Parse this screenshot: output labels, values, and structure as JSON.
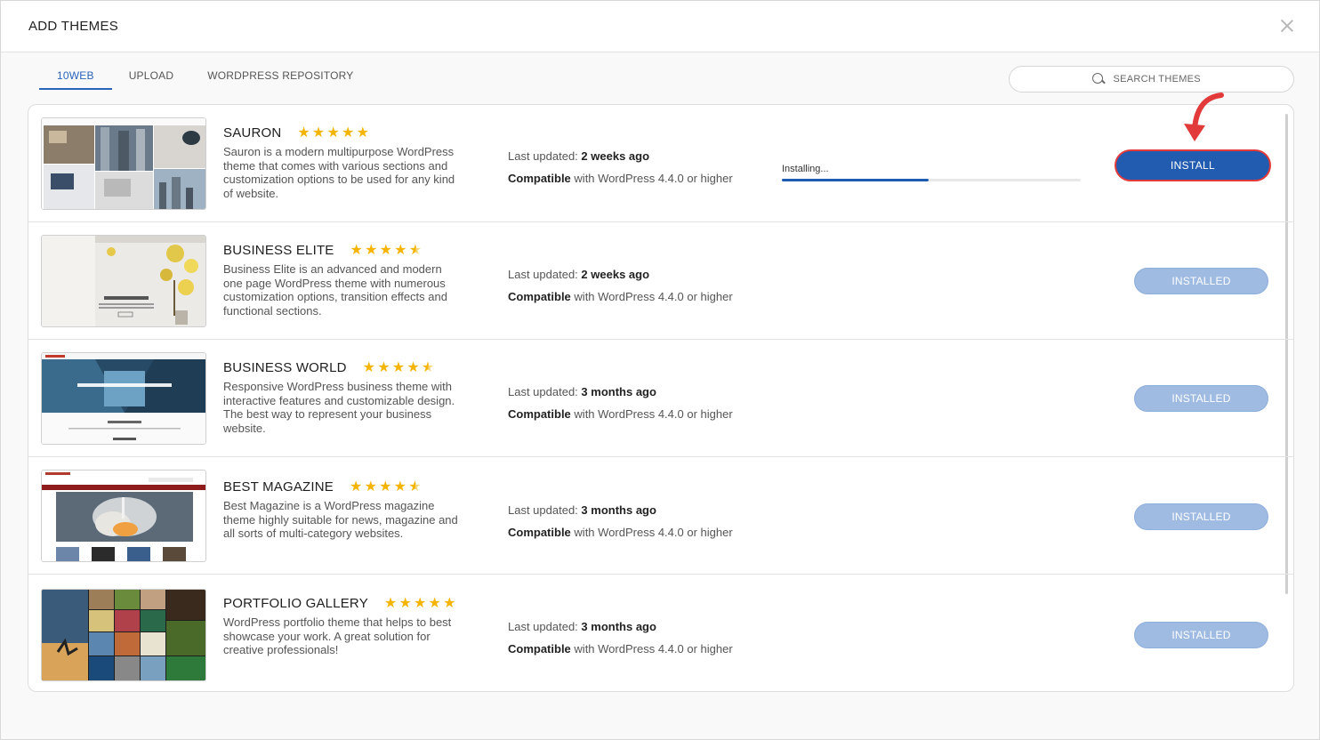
{
  "modal": {
    "title": "ADD THEMES"
  },
  "tabs": [
    {
      "label": "10WEB",
      "active": true
    },
    {
      "label": "UPLOAD",
      "active": false
    },
    {
      "label": "WORDPRESS REPOSITORY",
      "active": false
    }
  ],
  "search": {
    "placeholder": "SEARCH THEMES"
  },
  "meta_labels": {
    "last_updated": "Last updated:",
    "compatible": "Compatible",
    "compat_text": "with WordPress 4.4.0 or higher"
  },
  "themes": [
    {
      "name": "SAURON",
      "rating": 5,
      "description": "Sauron is a modern multipurpose WordPress theme that comes with various sections and customization options to be used for any kind of website.",
      "last_updated": "2 weeks ago",
      "status": "installing",
      "progress_label": "Installing...",
      "progress": 0.49,
      "button": "INSTALL"
    },
    {
      "name": "BUSINESS ELITE",
      "rating": 4.5,
      "description": "Business Elite is an advanced and modern one page WordPress theme with numerous customization options, transition effects and functional sections.",
      "last_updated": "2 weeks ago",
      "status": "installed",
      "button": "INSTALLED"
    },
    {
      "name": "BUSINESS WORLD",
      "rating": 4.5,
      "description": "Responsive WordPress business theme with interactive features and customizable design. The best way to represent your business website.",
      "last_updated": "3 months ago",
      "status": "installed",
      "button": "INSTALLED"
    },
    {
      "name": "BEST MAGAZINE",
      "rating": 4.5,
      "description": "Best Magazine is a WordPress magazine theme highly suitable for news, magazine and all sorts of multi-category websites.",
      "last_updated": "3 months ago",
      "status": "installed",
      "button": "INSTALLED"
    },
    {
      "name": "PORTFOLIO GALLERY",
      "rating": 5,
      "description": "WordPress portfolio theme that helps to best showcase your work. A great solution for creative professionals!",
      "last_updated": "3 months ago",
      "status": "installed",
      "button": "INSTALLED"
    }
  ],
  "colors": {
    "accent": "#215cb0",
    "installed_button": "#9fbbe2",
    "star": "#f5b400",
    "highlight": "#e23a3a"
  }
}
